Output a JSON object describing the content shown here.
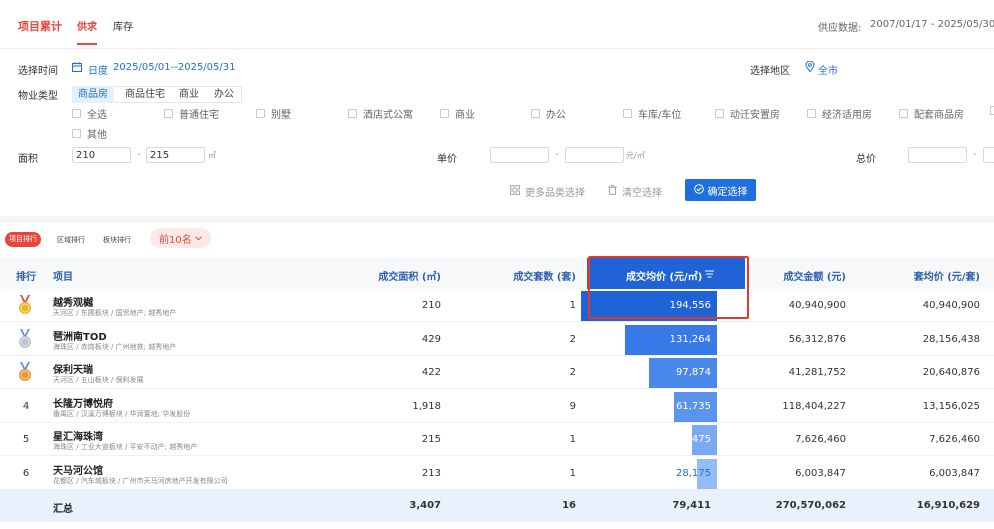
{
  "header": {
    "tabs": [
      {
        "label": "项目累计"
      },
      {
        "label": "供求"
      },
      {
        "label": "库存"
      }
    ],
    "supply_data_label": "供应数据:",
    "supply_data_range": "2007/01/17 - 2025/05/30"
  },
  "filters": {
    "time_label": "选择时间",
    "time_mode": "日度",
    "time_range": "2025/05/01--2025/05/31",
    "region_label": "选择地区",
    "region_value": "全市",
    "property_label": "物业类型",
    "property_tabs": [
      "商品房",
      "商品住宅",
      "商业",
      "办公"
    ],
    "checkboxes": [
      "全选",
      "普通住宅",
      "别墅",
      "酒店式公寓",
      "商业",
      "办公",
      "车库/车位",
      "动迁安置房",
      "经济适用房",
      "配套商品房",
      "其他"
    ],
    "area_label": "面积",
    "area_min": "210",
    "area_max": "215",
    "area_unit": "㎡",
    "area_sep": "-",
    "price_label": "单价",
    "price_unit": "元/㎡",
    "price_sep": "-",
    "total_label": "总价",
    "total_sep": "-",
    "more_label": "更多品类选择",
    "clear_label": "清空选择",
    "confirm_label": "确定选择"
  },
  "ranking": {
    "tabs": [
      "项目排行",
      "区域排行",
      "板块排行"
    ],
    "top_n": "前10名",
    "columns": {
      "rank": "排行",
      "project": "项目",
      "area": "成交面积 (㎡)",
      "count": "成交套数 (套)",
      "avg_price": "成交均价 (元/㎡)",
      "amount": "成交金额 (元)",
      "unit_avg": "套均价 (元/套)"
    },
    "rows": [
      {
        "rank": "1",
        "name": "越秀观樾",
        "sub": "天河区 / 东圃板块 / 国贸地产; 越秀地产",
        "area": "210",
        "count": "1",
        "avg": "194,556",
        "avg_value": 194556,
        "amount": "40,940,900",
        "unit": "40,940,900"
      },
      {
        "rank": "2",
        "name": "琶洲南TOD",
        "sub": "海珠区 / 赤岗板块 / 广州地铁; 越秀地产",
        "area": "429",
        "count": "2",
        "avg": "131,264",
        "avg_value": 131264,
        "amount": "56,312,876",
        "unit": "28,156,438"
      },
      {
        "rank": "3",
        "name": "保利天瑞",
        "sub": "天河区 / 五山板块 / 保利发展",
        "area": "422",
        "count": "2",
        "avg": "97,874",
        "avg_value": 97874,
        "amount": "41,281,752",
        "unit": "20,640,876"
      },
      {
        "rank": "4",
        "name": "长隆万博悦府",
        "sub": "番禺区 / 汉溪万博板块 / 华润置地; 华发股份",
        "area": "1,918",
        "count": "9",
        "avg": "61,735",
        "avg_value": 61735,
        "amount": "118,404,227",
        "unit": "13,156,025"
      },
      {
        "rank": "5",
        "name": "星汇海珠湾",
        "sub": "海珠区 / 工业大道板块 / 平安不动产; 越秀地产",
        "area": "215",
        "count": "1",
        "avg": "35,475",
        "avg_value": 35475,
        "amount": "7,626,460",
        "unit": "7,626,460"
      },
      {
        "rank": "6",
        "name": "天马河公馆",
        "sub": "花都区 / 汽车城板块 / 广州市天马河房地产开发有限公司",
        "area": "213",
        "count": "1",
        "avg": "28,175",
        "avg_value": 28175,
        "amount": "6,003,847",
        "unit": "6,003,847"
      }
    ],
    "total": {
      "label": "汇总",
      "area": "3,407",
      "count": "16",
      "avg": "79,411",
      "amount": "270,570,062",
      "unit": "16,910,629"
    }
  },
  "colors": {
    "accent_red": "#e8453c",
    "accent_blue": "#1f6fe0",
    "gold": "#f0b429",
    "silver": "#b9c3cf",
    "bronze": "#e8963a"
  }
}
